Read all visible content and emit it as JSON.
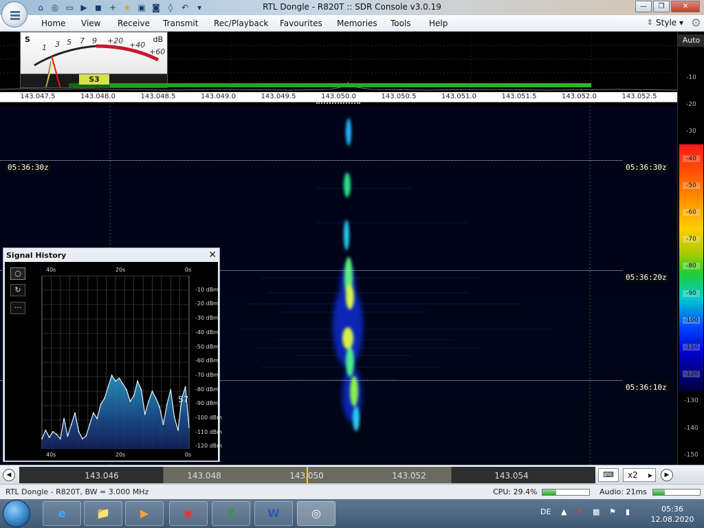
{
  "window": {
    "title": "RTL Dongle - R820T :: SDR Console v3.0.19"
  },
  "quick_access": [
    "home-icon",
    "help-ring-icon",
    "folder-icon",
    "play-icon",
    "stop-icon",
    "plus-icon",
    "favourite-star-icon",
    "lock-icon",
    "camera-icon",
    "tuning-drop-icon",
    "undo-icon",
    "dropdown-arrow-icon"
  ],
  "menu": {
    "items": [
      "Home",
      "View",
      "Receive",
      "Transmit",
      "Rec/Playback",
      "Favourites",
      "Memories",
      "Tools",
      "Help"
    ],
    "style": "Style"
  },
  "smeter": {
    "s_label": "S",
    "db_label": "dB",
    "scale": [
      "1",
      "3",
      "5",
      "7",
      "9",
      "+20",
      "+40",
      "+60"
    ],
    "reading": "S3",
    "level_fraction": 0.88
  },
  "frequency_scale": {
    "labels": [
      "143.047.5",
      "143.048.0",
      "143.048.5",
      "143.049.0",
      "143.049.5",
      "143.050.0",
      "143.050.5",
      "143.051.0",
      "143.051.5",
      "143.052.0",
      "143.052.5"
    ]
  },
  "right_scale": {
    "auto": "Auto",
    "labels": [
      "-10",
      "-20",
      "-30",
      "-40",
      "-50",
      "-60",
      "-70",
      "-80",
      "-90",
      "-100",
      "-110",
      "-120",
      "-130",
      "-140",
      "-150"
    ]
  },
  "timestamps": [
    "05:36:30z",
    "05:36:20z",
    "05:36:10z"
  ],
  "signal_history": {
    "title": "Signal History",
    "close": "✕",
    "buttons": [
      "○",
      "↻",
      "···"
    ],
    "time_labels": [
      "40s",
      "20s",
      "0s"
    ],
    "db_labels": [
      "-10 dBm",
      "-20 dBm",
      "-30 dBm",
      "-40 dBm",
      "-50 dBm",
      "-60 dBm",
      "-70 dBm",
      "-80 dBm",
      "-90 dBm",
      "-100 dBm",
      "-110 dBm",
      "-120 dBm"
    ],
    "peak_label": "S7",
    "chart_data": {
      "type": "area",
      "xlabel": "",
      "ylabel": "",
      "xlim": [
        40,
        0
      ],
      "ylim": [
        -125,
        -5
      ],
      "x": [
        40,
        39,
        38,
        37,
        36,
        35,
        34,
        33,
        32,
        31,
        30,
        29,
        28,
        27,
        26,
        25,
        24,
        23,
        22,
        21,
        20,
        19,
        18,
        17,
        16,
        15,
        14,
        13,
        12,
        11,
        10,
        9,
        8,
        7,
        6,
        5,
        4,
        3,
        2,
        1,
        0
      ],
      "series": [
        {
          "values": [
            -118,
            -112,
            -117,
            -113,
            -115,
            -118,
            -104,
            -116,
            -108,
            -100,
            -113,
            -118,
            -116,
            -108,
            -100,
            -104,
            -94,
            -90,
            -82,
            -74,
            -78,
            -76,
            -80,
            -84,
            -92,
            -88,
            -78,
            -84,
            -101,
            -92,
            -85,
            -90,
            -96,
            -108,
            -94,
            -84,
            -103,
            -112,
            -90,
            -82,
            -110
          ]
        }
      ]
    }
  },
  "bottom_tuner": {
    "labels": [
      "143.046",
      "143.048",
      "143.050",
      "143.052",
      "143.054"
    ],
    "zoom": "x2"
  },
  "status": {
    "left": "RTL Dongle - R820T, BW = 3.000 MHz",
    "cpu": "CPU: 29.4%",
    "cpu_fraction": 0.294,
    "audio": "Audio: 21ms",
    "audio_fraction": 0.25
  },
  "taskbar": {
    "apps": [
      "internet-explorer-icon",
      "file-explorer-icon",
      "media-player-icon",
      "chrome-icon",
      "excel-icon",
      "word-icon",
      "sdr-console-icon"
    ],
    "lang": "DE",
    "time": "05:36",
    "date": "12.08.2020"
  }
}
